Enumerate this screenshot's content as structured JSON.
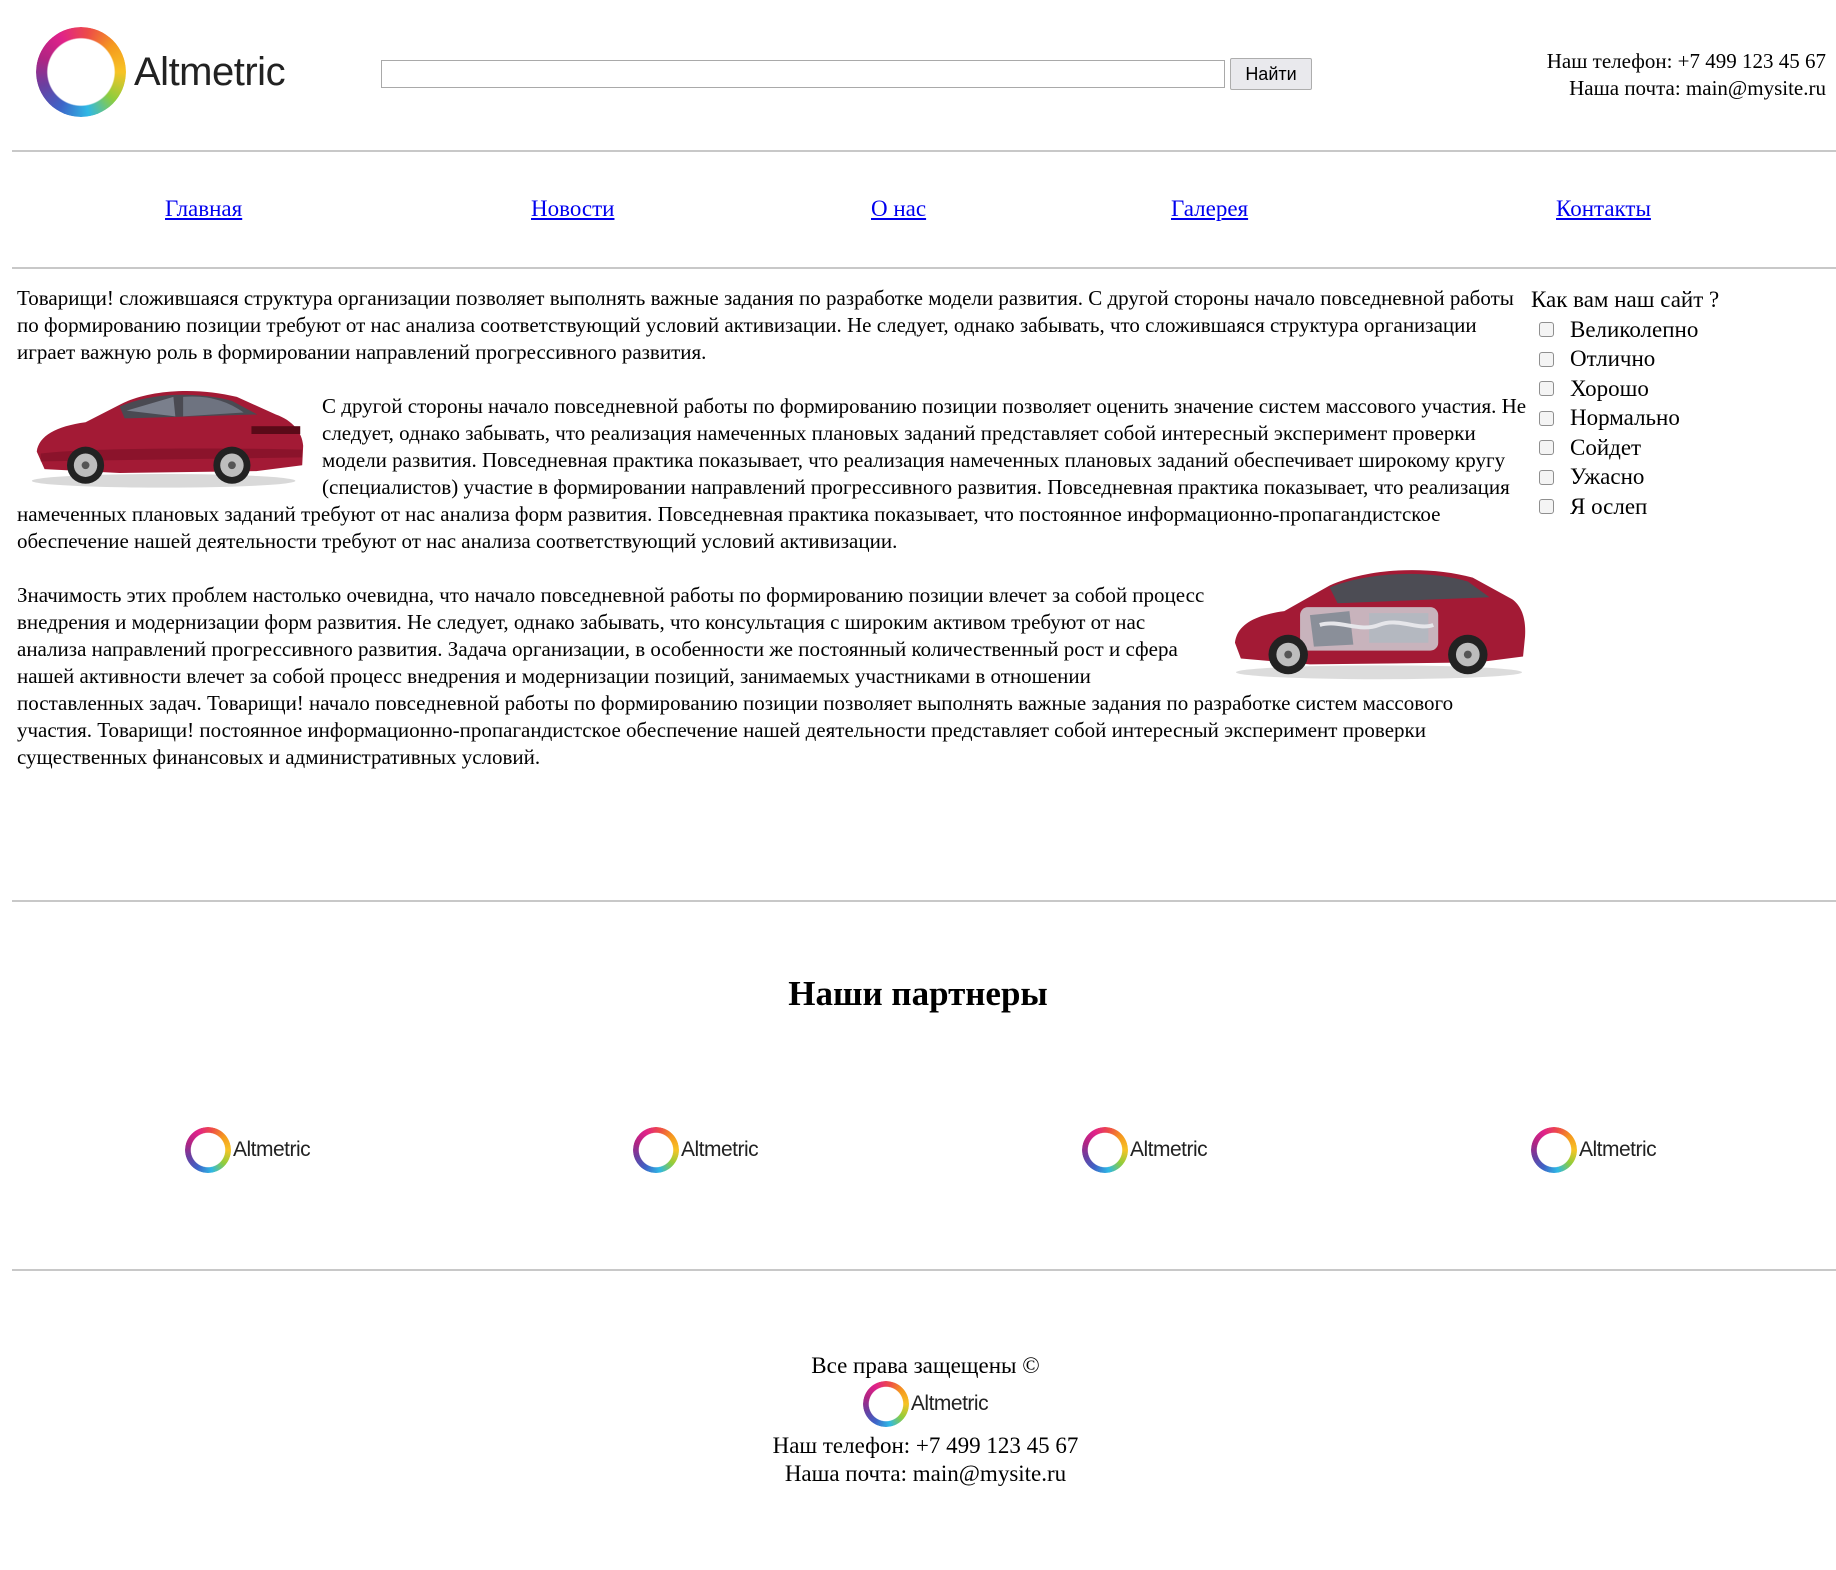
{
  "brand": {
    "logo_text": "Altmetric"
  },
  "search": {
    "value": "",
    "placeholder": "",
    "button_label": "Найти"
  },
  "header": {
    "phone": "Наш телефон: +7 499 123 45 67",
    "email": "Наша почта: main@mysite.ru"
  },
  "nav": {
    "items": [
      {
        "label": "Главная"
      },
      {
        "label": "Новости"
      },
      {
        "label": "О нас"
      },
      {
        "label": "Галерея"
      },
      {
        "label": "Контакты"
      }
    ]
  },
  "content": {
    "paragraph1": "Товарищи! сложившаяся структура организации позволяет выполнять важные задания по разработке модели развития. С другой стороны начало повседневной работы по формированию позиции требуют от нас анализа соответствующий условий активизации. Не следует, однако забывать, что сложившаяся структура организации играет важную роль в формировании направлений прогрессивного развития.",
    "paragraph2": "С другой стороны начало повседневной работы по формированию позиции позволяет оценить значение систем массового участия. Не следует, однако забывать, что реализация намеченных плановых заданий представляет собой интересный эксперимент проверки модели развития. Повседневная практика показывает, что реализация намеченных плановых заданий обеспечивает широкому кругу (специалистов) участие в формировании направлений прогрессивного развития. Повседневная практика показывает, что реализация намеченных плановых заданий требуют от нас анализа форм развития. Повседневная практика показывает, что постоянное информационно-пропагандистское обеспечение нашей деятельности требуют от нас анализа соответствующий условий активизации.",
    "paragraph3": "Значимость этих проблем настолько очевидна, что начало повседневной работы по формированию позиции влечет за собой процесс внедрения и модернизации форм развития. Не следует, однако забывать, что консультация с широким активом требуют от нас анализа направлений прогрессивного развития. Задача организации, в особенности же постоянный количественный рост и сфера нашей активности влечет за собой процесс внедрения и модернизации позиций, занимаемых участниками в отношении поставленных задач. Товарищи! начало повседневной работы по формированию позиции позволяет выполнять важные задания по разработке систем массового участия. Товарищи! постоянное информационно-пропагандистское обеспечение нашей деятельности представляет собой интересный эксперимент проверки существенных финансовых и административных условий."
  },
  "poll": {
    "question": "Как вам наш сайт ?",
    "options": [
      {
        "label": "Великолепно",
        "checked": false
      },
      {
        "label": "Отлично",
        "checked": false
      },
      {
        "label": "Хорошо",
        "checked": false
      },
      {
        "label": "Нормально",
        "checked": false
      },
      {
        "label": "Сойдет",
        "checked": false
      },
      {
        "label": "Ужасно",
        "checked": false
      },
      {
        "label": "Я ослеп",
        "checked": false
      }
    ]
  },
  "partners": {
    "title": "Наши партнеры",
    "items": [
      {
        "logo_text": "Altmetric"
      },
      {
        "logo_text": "Altmetric"
      },
      {
        "logo_text": "Altmetric"
      },
      {
        "logo_text": "Altmetric"
      }
    ]
  },
  "footer": {
    "rights": "Все права защещены ©",
    "logo_text": "Altmetric",
    "phone": "Наш телефон: +7 499 123 45 67",
    "email": "Наша почта: main@mysite.ru"
  },
  "colors": {
    "link": "#0000ee",
    "divider": "#c8c8c8",
    "car": "#a31a35"
  }
}
